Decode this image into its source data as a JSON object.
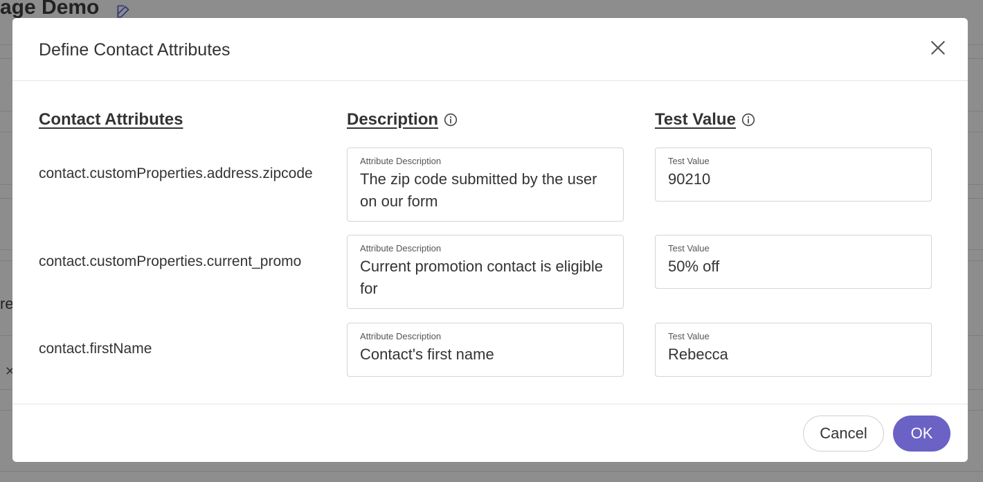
{
  "background": {
    "title_fragment": "age Demo",
    "side_fragment": "re"
  },
  "modal": {
    "title": "Define Contact Attributes",
    "columns": {
      "attributes": "Contact Attributes",
      "description": "Description",
      "test_value": "Test Value"
    },
    "rows": [
      {
        "attribute": "contact.customProperties.address.zipcode",
        "description_label": "Attribute Description",
        "description": "The zip code submitted by the user on our form",
        "test_label": "Test Value",
        "test_value": "90210"
      },
      {
        "attribute": "contact.customProperties.current_promo",
        "description_label": "Attribute Description",
        "description": "Current promotion contact is eligible for",
        "test_label": "Test Value",
        "test_value": "50% off"
      },
      {
        "attribute": "contact.firstName",
        "description_label": "Attribute Description",
        "description": "Contact's first name",
        "test_label": "Test Value",
        "test_value": "Rebecca"
      }
    ],
    "buttons": {
      "cancel": "Cancel",
      "ok": "OK"
    }
  },
  "colors": {
    "accent": "#6a62c5",
    "overlay": "#8d8d8d"
  }
}
